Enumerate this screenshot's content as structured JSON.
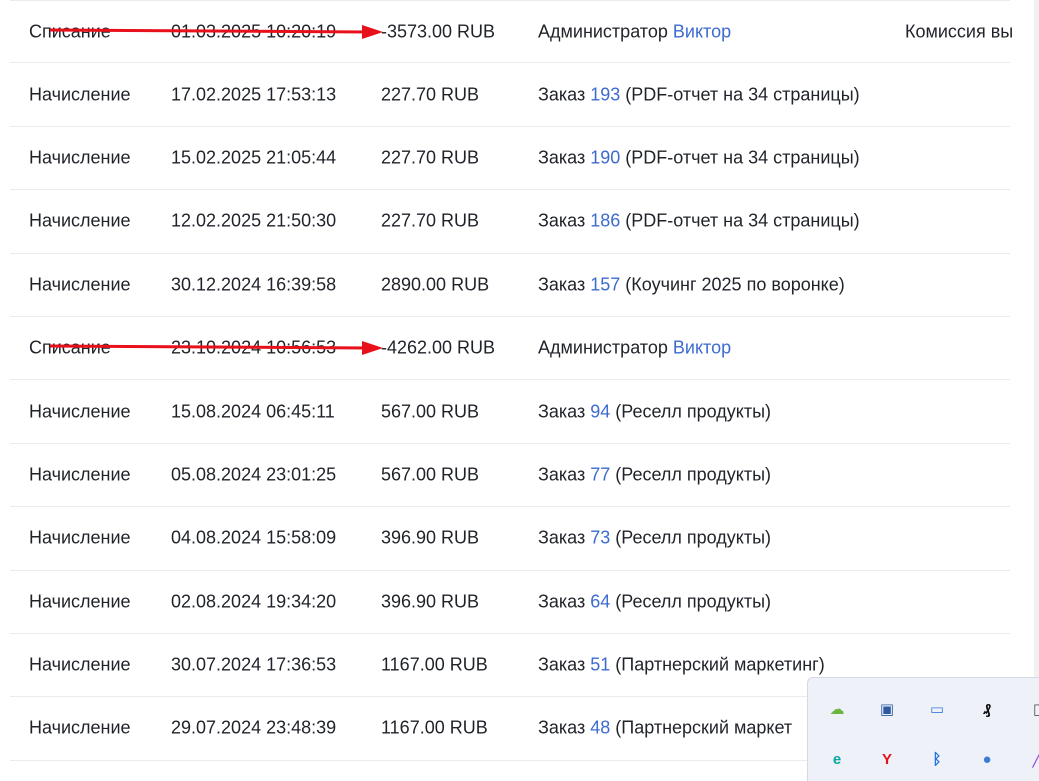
{
  "transactions": [
    {
      "type": "Списание",
      "date": "01.03.2025 10:20:19",
      "amount": "-3573.00 RUB",
      "desc_prefix": "Администратор",
      "desc_link": "Виктор",
      "desc_suffix": "",
      "note": "Комиссия вы",
      "struck": true
    },
    {
      "type": "Начисление",
      "date": "17.02.2025 17:53:13",
      "amount": "227.70 RUB",
      "desc_prefix": "Заказ",
      "desc_link": "193",
      "desc_suffix": "(PDF-отчет на 34 страницы)",
      "note": "",
      "struck": false
    },
    {
      "type": "Начисление",
      "date": "15.02.2025 21:05:44",
      "amount": "227.70 RUB",
      "desc_prefix": "Заказ",
      "desc_link": "190",
      "desc_suffix": "(PDF-отчет на 34 страницы)",
      "note": "",
      "struck": false
    },
    {
      "type": "Начисление",
      "date": "12.02.2025 21:50:30",
      "amount": "227.70 RUB",
      "desc_prefix": "Заказ",
      "desc_link": "186",
      "desc_suffix": "(PDF-отчет на 34 страницы)",
      "note": "",
      "struck": false
    },
    {
      "type": "Начисление",
      "date": "30.12.2024 16:39:58",
      "amount": "2890.00 RUB",
      "desc_prefix": "Заказ",
      "desc_link": "157",
      "desc_suffix": "(Коучинг 2025 по воронке)",
      "note": "",
      "struck": false
    },
    {
      "type": "Списание",
      "date": "23.10.2024 10:56:53",
      "amount": "-4262.00 RUB",
      "desc_prefix": "Администратор",
      "desc_link": "Виктор",
      "desc_suffix": "",
      "note": "",
      "struck": true
    },
    {
      "type": "Начисление",
      "date": "15.08.2024 06:45:11",
      "amount": "567.00 RUB",
      "desc_prefix": "Заказ",
      "desc_link": "94",
      "desc_suffix": "(Реселл продукты)",
      "note": "",
      "struck": false
    },
    {
      "type": "Начисление",
      "date": "05.08.2024 23:01:25",
      "amount": "567.00 RUB",
      "desc_prefix": "Заказ",
      "desc_link": "77",
      "desc_suffix": "(Реселл продукты)",
      "note": "",
      "struck": false
    },
    {
      "type": "Начисление",
      "date": "04.08.2024 15:58:09",
      "amount": "396.90 RUB",
      "desc_prefix": "Заказ",
      "desc_link": "73",
      "desc_suffix": "(Реселл продукты)",
      "note": "",
      "struck": false
    },
    {
      "type": "Начисление",
      "date": "02.08.2024 19:34:20",
      "amount": "396.90 RUB",
      "desc_prefix": "Заказ",
      "desc_link": "64",
      "desc_suffix": "(Реселл продукты)",
      "note": "",
      "struck": false
    },
    {
      "type": "Начисление",
      "date": "30.07.2024 17:36:53",
      "amount": "1167.00 RUB",
      "desc_prefix": "Заказ",
      "desc_link": "51",
      "desc_suffix": "(Партнерский маркетинг)",
      "note": "",
      "struck": false
    },
    {
      "type": "Начисление",
      "date": "29.07.2024 23:48:39",
      "amount": "1167.00 RUB",
      "desc_prefix": "Заказ",
      "desc_link": "48",
      "desc_suffix": "(Партнерский маркет",
      "note": "",
      "struck": false
    }
  ],
  "colors": {
    "arrow": "#e8101a",
    "link": "#3d6bd0",
    "text": "#1f2329"
  },
  "tray": [
    {
      "name": "cloud-sync-icon",
      "glyph": "☁",
      "color": "#6db33f"
    },
    {
      "name": "network-icon",
      "glyph": "▣",
      "color": "#2c5aa0"
    },
    {
      "name": "remote-desktop-icon",
      "glyph": "▭",
      "color": "#3a7bd5"
    },
    {
      "name": "notion-icon",
      "glyph": "₰",
      "color": "#111111"
    },
    {
      "name": "window-icon",
      "glyph": "▯",
      "color": "#555555"
    },
    {
      "name": "eset-icon",
      "glyph": "e",
      "color": "#0aa7a0"
    },
    {
      "name": "yandex-icon",
      "glyph": "Y",
      "color": "#e8101a"
    },
    {
      "name": "bluetooth-icon",
      "glyph": "ᛒ",
      "color": "#1e72e0"
    },
    {
      "name": "browser-badge-icon",
      "glyph": "●",
      "color": "#3a7bd5"
    },
    {
      "name": "pen-icon",
      "glyph": "╱",
      "color": "#8a4fd8"
    }
  ]
}
